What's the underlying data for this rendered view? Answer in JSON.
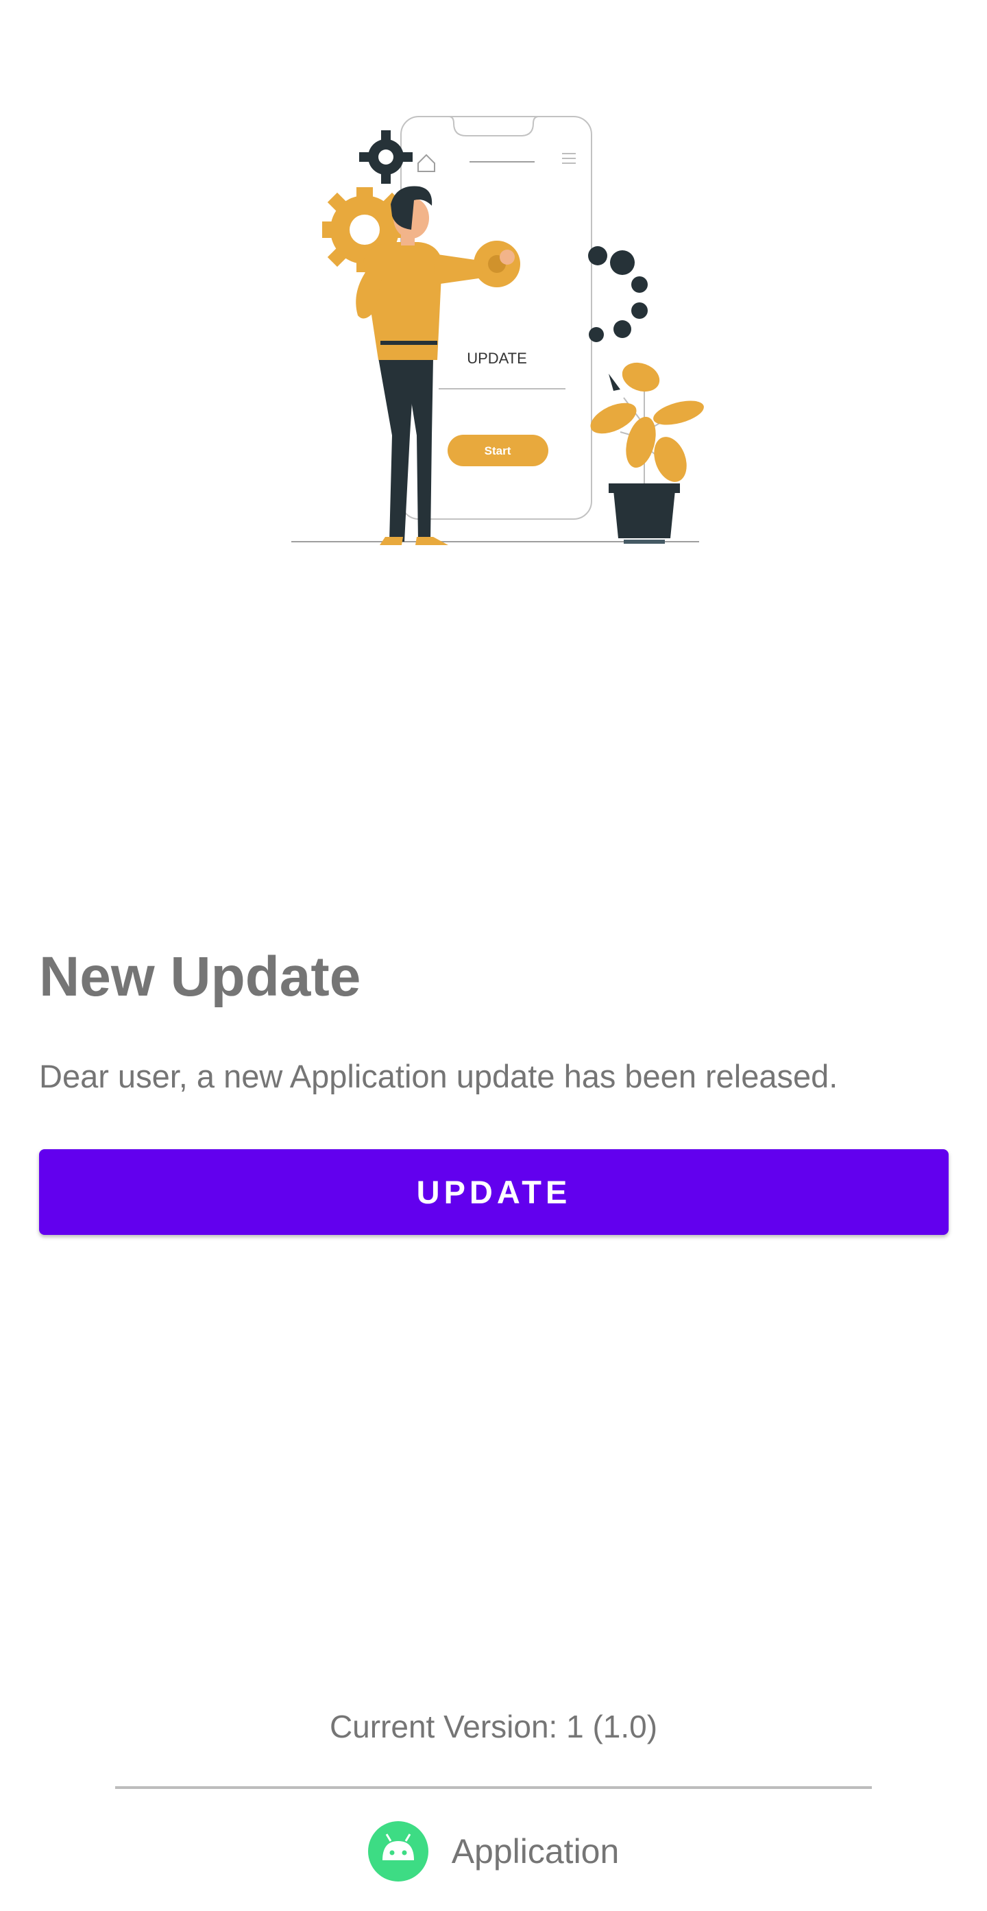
{
  "illustration": {
    "screen_heading": "UPDATE",
    "screen_button": "Start"
  },
  "update": {
    "title": "New Update",
    "message": "Dear user, a new Application update has been released.",
    "button_label": "UPDATE"
  },
  "footer": {
    "version_text": "Current Version: 1 (1.0)",
    "app_name": "Application"
  },
  "colors": {
    "accent": "#6200ee",
    "illustration_yellow": "#e8a93d",
    "illustration_dark": "#263238",
    "android_green": "#3ddc84"
  }
}
